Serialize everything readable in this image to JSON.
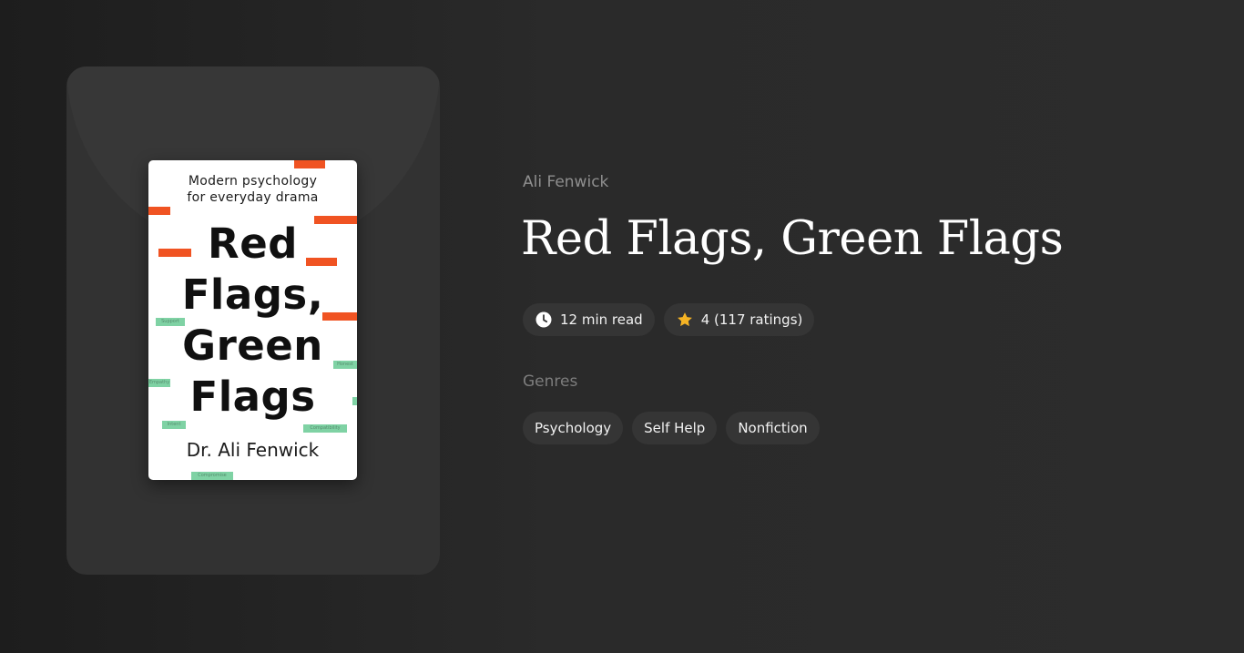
{
  "book": {
    "author": "Ali Fenwick",
    "title": "Red Flags, Green Flags",
    "read_time": "12 min read",
    "rating": "4 (117 ratings)",
    "genres_label": "Genres",
    "genres": [
      "Psychology",
      "Self Help",
      "Nonfiction"
    ]
  },
  "cover": {
    "subtitle_line1": "Modern psychology",
    "subtitle_line2": "for everyday drama",
    "title_line1": "Red",
    "title_line2": "Flags,",
    "title_line3": "Green",
    "title_line4": "Flags",
    "author": "Dr. Ali Fenwick",
    "green_flag_words": [
      "Support",
      "Honest",
      "Empathy",
      "Intent",
      "Compatibility",
      "Compromise"
    ]
  },
  "icons": {
    "read_time": "clock-icon",
    "rating": "star-icon"
  },
  "colors": {
    "star": "#f5b324",
    "red_flag": "#f05322",
    "green_flag": "#7fd2a4"
  }
}
